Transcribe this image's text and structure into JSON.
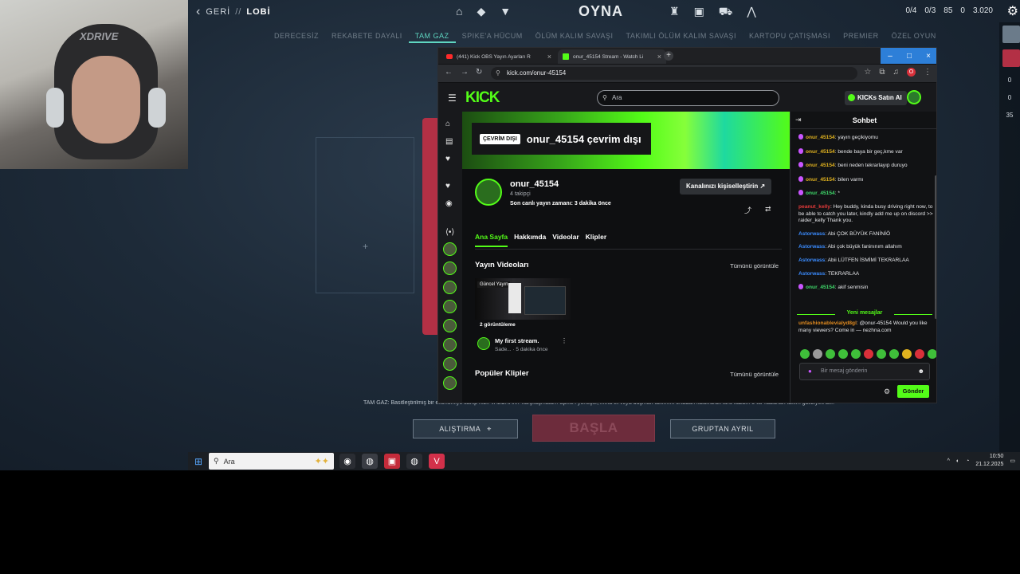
{
  "game": {
    "back_label": "GERİ",
    "sep": "//",
    "lobby_label": "LOBİ",
    "play_label": "OYNA",
    "stats": [
      "0/4",
      "0/3",
      "85",
      "0",
      "3.020"
    ],
    "modes": [
      "DERECESİZ",
      "REKABETE DAYALI",
      "TAM GAZ",
      "SPIKE'A HÜCUM",
      "ÖLÜM KALIM SAVAŞI",
      "TAKIMLI ÖLÜM KALIM SAVAŞI",
      "KARTOPU ÇATIŞMASI",
      "PREMIER",
      "ÖZEL OYUN"
    ],
    "active_mode_index": 2,
    "mode_description": "TAM GAZ: Basitleştirilmiş bir ekonomiye sahip hızlı VALORANT karşılaşmaları. Spike'ı yerleştir, imha et veya düşman takımını ortadan kaldırarak turu kazan. 5 tur kazanan takım galibiyeti alır.",
    "practice_label": "ALIŞTIRMA",
    "start_label": "BAŞLA",
    "leave_label": "GRUPTAN AYRIL",
    "right_numbers": [
      "0",
      "0",
      "35"
    ]
  },
  "webcam": {
    "headset_brand": "XDRIVE"
  },
  "taskbar": {
    "search_placeholder": "Ara",
    "time": "10:50",
    "date": "21.12.2025"
  },
  "browser": {
    "tabs": [
      {
        "label": "(441) Kick OBS Yayın Ayarları R"
      },
      {
        "label": "onur_45154 Stream - Watch Li"
      }
    ],
    "url": "kick.com/onur-45154",
    "profile_initial": "O"
  },
  "kick": {
    "logo": "KICK",
    "search_placeholder": "Ara",
    "buy_kicks_label": "KICKs Satın Al",
    "offline_badge": "ÇEVRİM DIŞI",
    "offline_title": "onur_45154 çevrim dışı",
    "channel_name": "onur_45154",
    "followers": "4 takipçi",
    "last_live": "Son canlı yayın zamanı: 3 dakika önce",
    "customize_label": "Kanalınızı kişiselleştirin",
    "tabs": [
      "Ana Sayfa",
      "Hakkımda",
      "Videolar",
      "Klipler"
    ],
    "videos_title": "Yayın Videoları",
    "see_all": "Tümünü görüntüle",
    "video": {
      "badge": "Güncel Yayın",
      "views": "2 görüntüleme",
      "title": "My first stream.",
      "meta_author": "Sade...",
      "meta_time": "· 5 dakika önce"
    },
    "clips_title": "Popüler Klipler"
  },
  "chat": {
    "title": "Sohbet",
    "messages": [
      {
        "user": "onur_45154",
        "text": ": yayın geçikiyomu",
        "color": "#e0b21f",
        "badge": true
      },
      {
        "user": "onur_45154",
        "text": ": bende baya bir geç,kme var",
        "color": "#e0b21f",
        "badge": true
      },
      {
        "user": "onur_45154",
        "text": ": beni neden tekrarlayıp duruyo",
        "color": "#e0b21f",
        "badge": true
      },
      {
        "user": "onur_45154",
        "text": ": bilen varmı",
        "color": "#e0b21f",
        "badge": true
      },
      {
        "user": "onur_45154",
        "text": ": *",
        "color": "#3fd86a",
        "badge": true
      },
      {
        "user": "peanut_kelly",
        "text": ": Hey buddy, kinda busy driving right now, to be able to catch you later, kindly add me up on discord >> raider_kelly Thank you.",
        "color": "#e23a3a",
        "badge": false
      },
      {
        "user": "Astorwass",
        "text": ": Abi ÇOK BÜYÜK FANİNİÖ",
        "color": "#3b8cff",
        "badge": false
      },
      {
        "user": "Astorwass",
        "text": ": Abi çok büyük faninınım allahım",
        "color": "#3b8cff",
        "badge": false
      },
      {
        "user": "Astorwass",
        "text": ": Abii LÜTFEN İSMİMİ TEKRARLAA",
        "color": "#3b8cff",
        "badge": false
      },
      {
        "user": "Astorwass",
        "text": ": TEKRARLAA",
        "color": "#3b8cff",
        "badge": false
      },
      {
        "user": "onur_45154",
        "text": ": akif senmisin",
        "color": "#3fd86a",
        "badge": true
      }
    ],
    "new_messages_label": "Yeni mesajlar",
    "new_message": {
      "user": "unfashionablevialyd8gl",
      "text": ": @onur-45154 Would you like many viewers? Come in — nezhna.com",
      "color": "#e08a1f"
    },
    "input_placeholder": "Bir mesaj gönderin",
    "send_label": "Gönder"
  },
  "colors": {
    "kick_green": "#53fc18",
    "valorant_red": "#b33045",
    "active_mode": "#5fd6c1"
  }
}
